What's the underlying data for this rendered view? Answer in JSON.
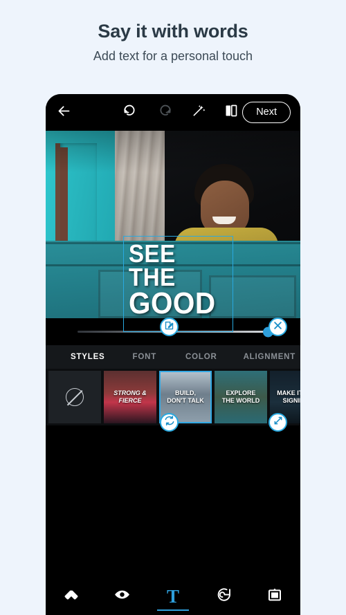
{
  "promo": {
    "title": "Say it with words",
    "subtitle": "Add text for a personal touch"
  },
  "colors": {
    "page_bg": "#eef4fc",
    "accent_blue": "#2e9fdc",
    "selection_blue": "#32a9e4",
    "app_bg": "#000000",
    "panel_bg": "#15181b",
    "title_text": "#2b3a46"
  },
  "toolbar": {
    "back_icon": "back-arrow-icon",
    "undo_icon": "undo-icon",
    "redo_icon": "redo-icon",
    "magic_icon": "magic-wand-icon",
    "compare_icon": "compare-split-icon",
    "next_label": "Next"
  },
  "canvas": {
    "overlay_text_line1": "SEE THE",
    "overlay_text_line2": "GOOD",
    "handles": [
      {
        "name": "edit-handle",
        "icon": "edit-pencil-icon",
        "position": "top-left"
      },
      {
        "name": "delete-handle",
        "icon": "close-x-icon",
        "position": "top-right"
      },
      {
        "name": "rotate-handle",
        "icon": "rotate-refresh-icon",
        "position": "bottom-left"
      },
      {
        "name": "resize-handle",
        "icon": "resize-diagonal-icon",
        "position": "bottom-right"
      }
    ]
  },
  "slider": {
    "name": "opacity-slider",
    "value": 100,
    "min": 0,
    "max": 100
  },
  "tabs": [
    {
      "label": "STYLES",
      "active": true
    },
    {
      "label": "FONT",
      "active": false
    },
    {
      "label": "COLOR",
      "active": false
    },
    {
      "label": "ALIGNMENT",
      "active": false
    }
  ],
  "style_thumbnails": [
    {
      "id": "none",
      "label": "",
      "icon": "no-style-icon",
      "selected": false
    },
    {
      "id": "strong-fierce",
      "label": "STRONG &\nFIERCE",
      "selected": false
    },
    {
      "id": "build-dont-talk",
      "label": "BUILD,\nDON'T TALK",
      "selected": true
    },
    {
      "id": "explore-the-world",
      "label": "EXPLORE\nTHE WORLD",
      "selected": false
    },
    {
      "id": "make-it-simple",
      "label": "MAKE IT SIM\nSIGNIFIC",
      "selected": false
    }
  ],
  "bottom_nav": [
    {
      "id": "heal",
      "icon": "heal-patch-icon",
      "active": false
    },
    {
      "id": "looks",
      "icon": "eye-icon",
      "active": false
    },
    {
      "id": "text",
      "icon": "text-t-icon",
      "label": "T",
      "active": true
    },
    {
      "id": "sticker",
      "icon": "sticker-swirl-icon",
      "active": false
    },
    {
      "id": "frame",
      "icon": "frame-icon",
      "active": false
    }
  ]
}
